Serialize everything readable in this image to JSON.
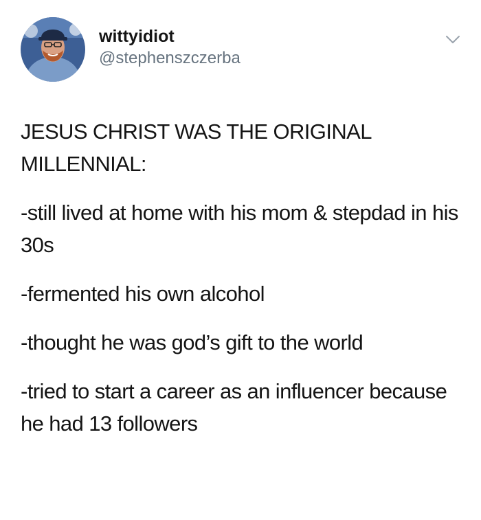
{
  "tweet": {
    "display_name": "wittyidiot",
    "handle": "@stephenszczerba",
    "avatar_icon": "profile-photo",
    "menu_icon": "chevron-down-icon",
    "accent_gray": "#66737f",
    "paragraphs": [
      "JESUS CHRIST WAS THE ORIGINAL MILLENNIAL:",
      "-still lived at home with his mom & stepdad in his 30s",
      "-fermented his own alcohol",
      "-thought he was god’s gift to the world",
      "-tried to start a career as an influencer because he had 13 followers"
    ]
  }
}
